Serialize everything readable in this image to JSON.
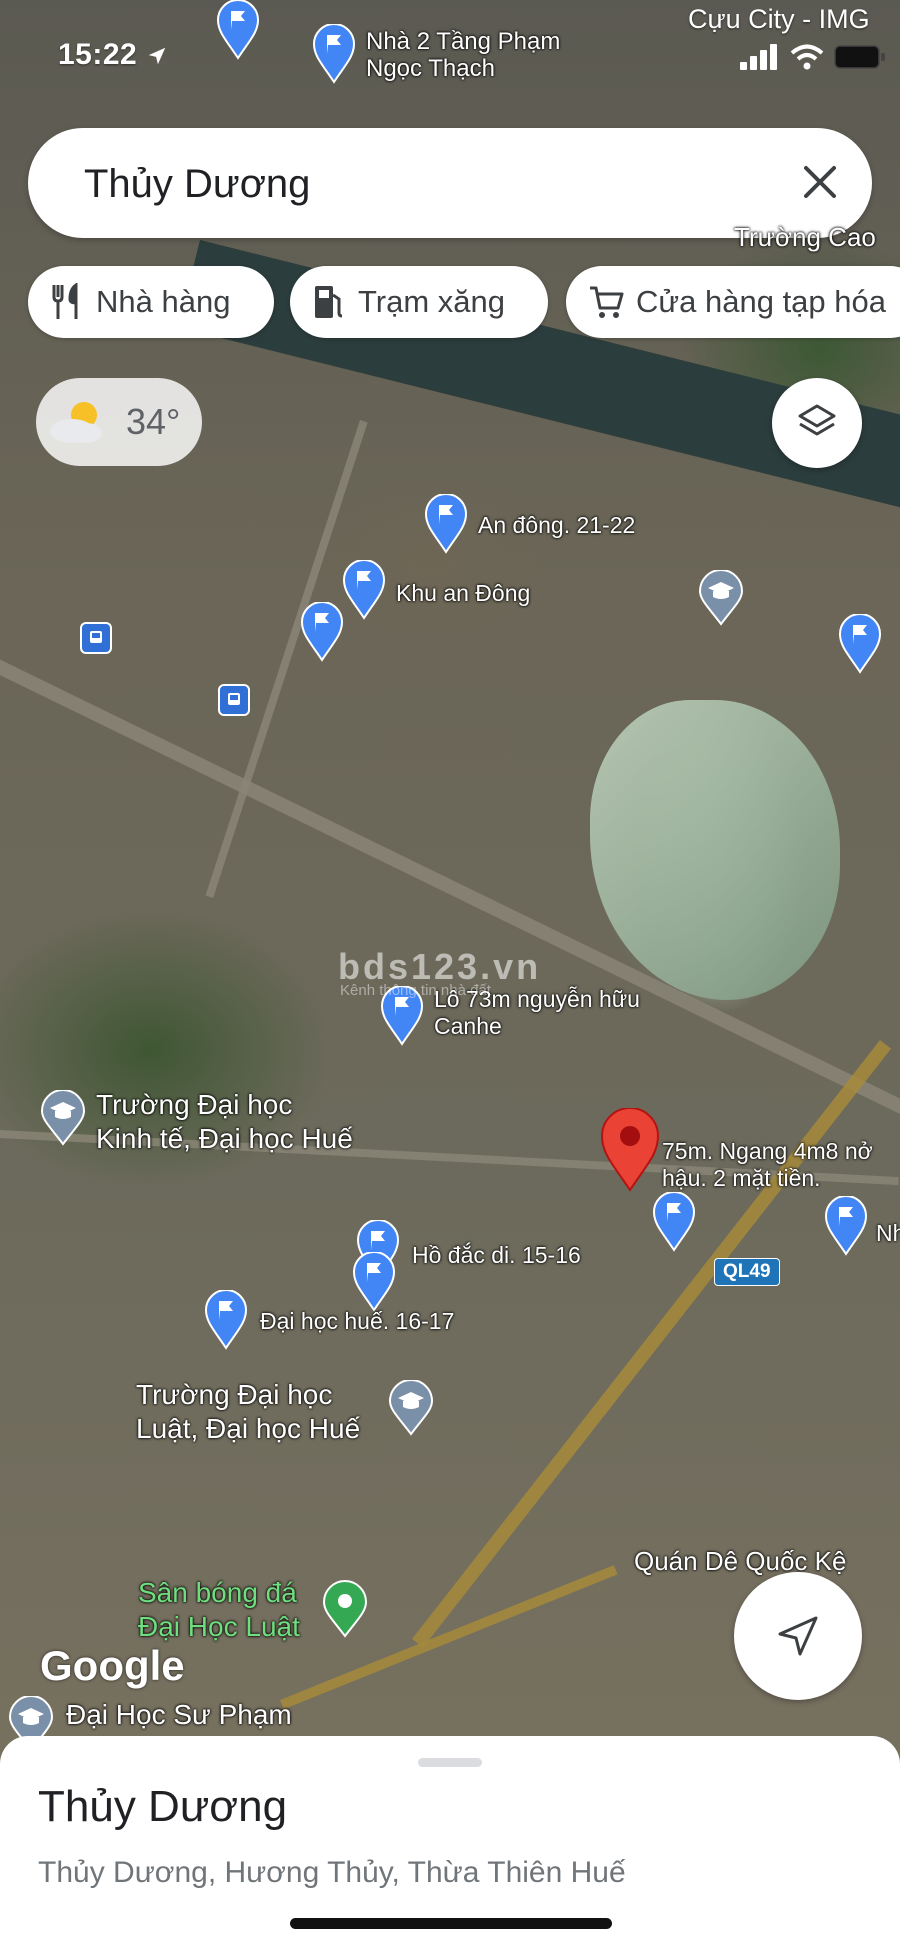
{
  "status_bar": {
    "time": "15:22",
    "carrier": "Cựu City - IMG"
  },
  "search": {
    "query": "Thủy Dương"
  },
  "chips": [
    {
      "label": "Nhà hàng",
      "icon": "restaurant-icon"
    },
    {
      "label": "Trạm xăng",
      "icon": "gas-station-icon"
    },
    {
      "label": "Cửa hàng tạp hóa",
      "icon": "shopping-cart-icon"
    }
  ],
  "weather": {
    "temperature": "34°",
    "icon": "partly-cloudy-icon"
  },
  "map_labels": {
    "nha_2_tang_line1": "Nhà 2 Tầng Phạm",
    "nha_2_tang_line2": "Ngọc Thạch",
    "truong_cao": "Trường Cao",
    "an_dong_2122": "An đông. 21-22",
    "khu_an_dong": "Khu an Đông",
    "lo_73m_line1": "Lô 73m nguyễn hữu",
    "lo_73m_line2": "Canhe",
    "dh_kinh_te_line1": "Trường Đại học",
    "dh_kinh_te_line2": "Kinh tế, Đại học Huế",
    "selected_line1": "75m. Ngang 4m8 nở",
    "selected_line2": "hậu. 2 mặt tiền.",
    "ho_dac_di": "Hồ đắc di. 15-16",
    "dai_hoc_hue": "Đại học huế. 16-17",
    "dh_luat_line1": "Trường Đại học",
    "dh_luat_line2": "Luật, Đại học Huế",
    "quan_de": "Quán Dê Quốc Kệ",
    "san_bong_line1": "Sân bóng đá",
    "san_bong_line2": "Đại Học Luật",
    "dh_su_pham": "Đại Học Sư Phạm",
    "edge_label": "Nh",
    "road_shield": "QL49"
  },
  "watermark": {
    "text": "bds123.vn",
    "sub": "Kênh thông tin nhà đất"
  },
  "google_logo": "Google",
  "place_sheet": {
    "title": "Thủy Dương",
    "address": "Thủy Dương, Hương Thủy, Thừa Thiên Huế"
  },
  "colors": {
    "pin_blue": "#4285f4",
    "pin_red": "#ea4335",
    "school_gray": "#7a8fa8",
    "park_green": "#34a853"
  }
}
